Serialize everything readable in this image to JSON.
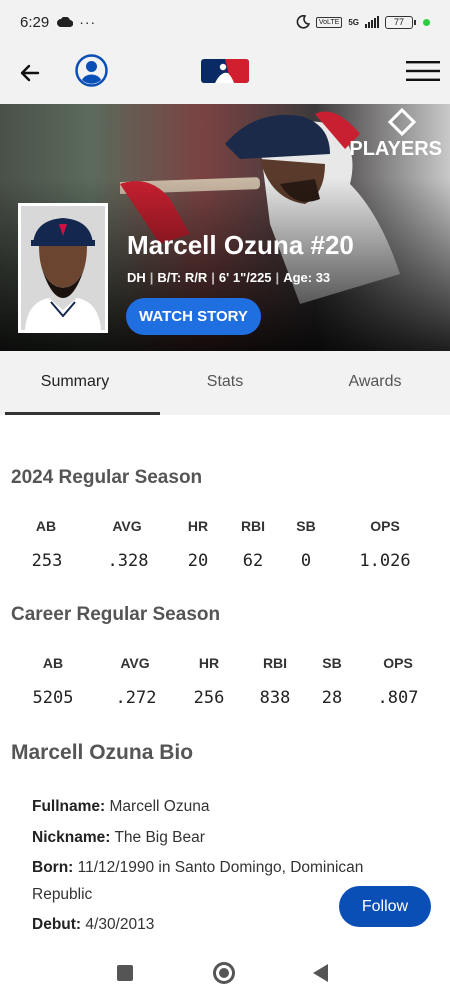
{
  "status_bar": {
    "time": "6:29",
    "dots": "···",
    "network": "5G",
    "volte": "VoLTE",
    "battery": "77"
  },
  "header": {
    "logo": "MLB"
  },
  "hero": {
    "name": "Marcell Ozuna #20",
    "position": "DH",
    "bats_throws": "B/T: R/R",
    "height_weight": "6' 1\"/225",
    "age": "Age: 33",
    "watch_label": "WATCH STORY",
    "players_logo": "PLAYERS"
  },
  "tabs": [
    {
      "label": "Summary",
      "active": true
    },
    {
      "label": "Stats",
      "active": false
    },
    {
      "label": "Awards",
      "active": false
    }
  ],
  "season": {
    "title": "2024 Regular Season",
    "headers": [
      "AB",
      "AVG",
      "HR",
      "RBI",
      "SB",
      "OPS"
    ],
    "values": [
      "253",
      ".328",
      "20",
      "62",
      "0",
      "1.026"
    ]
  },
  "career": {
    "title": "Career Regular Season",
    "headers": [
      "AB",
      "AVG",
      "HR",
      "RBI",
      "SB",
      "OPS"
    ],
    "values": [
      "5205",
      ".272",
      "256",
      "838",
      "28",
      ".807"
    ]
  },
  "bio": {
    "title": "Marcell Ozuna Bio",
    "fullname_label": "Fullname:",
    "fullname": "Marcell Ozuna",
    "nickname_label": "Nickname:",
    "nickname": "The Big Bear",
    "born_label": "Born:",
    "born_1": "11/12/1990 in Santo Domingo, Dominican",
    "born_2": "Republic",
    "debut_label": "Debut:",
    "debut": "4/30/2013"
  },
  "follow_label": "Follow",
  "icons": [
    "cloud-icon",
    "moon-icon",
    "signal-icon",
    "battery-icon",
    "back-arrow-icon",
    "profile-icon",
    "mlb-logo-icon",
    "menu-icon",
    "players-logo-icon",
    "recents-icon",
    "home-icon",
    "nav-back-icon"
  ]
}
